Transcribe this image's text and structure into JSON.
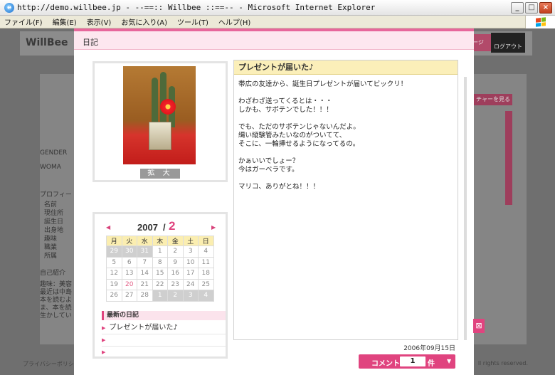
{
  "window": {
    "title": "http://demo.willbee.jp - --==:: Willbee ::==-- - Microsoft Internet Explorer",
    "menu": [
      "ファイル(F)",
      "編集(E)",
      "表示(V)",
      "お気に入り(A)",
      "ツール(T)",
      "ヘルプ(H)"
    ]
  },
  "background": {
    "logo": "WillBee",
    "logout": "ログアウト",
    "nav_partial": "ージ",
    "left_labels": [
      "GENDER",
      "WOMA",
      "プロフィー",
      "名前",
      "現住所",
      "誕生日",
      "出身地",
      "趣味",
      "職業",
      "所属",
      "自己紹介",
      "趣味：美容",
      "最近は中島",
      "本を読むよ",
      "ま、本を読",
      "生かしてい"
    ],
    "feature_button": "チャーを見る",
    "tab_numbers": [
      "4",
      "4",
      "4",
      "4"
    ],
    "footer_left": "プライバシーポリシ",
    "footer_right": "ll rights reserved."
  },
  "modal": {
    "header_title": "日記",
    "zoom_label": "拡 大",
    "entry": {
      "title": "プレゼントが届いた♪",
      "body": "帯広の友達から、誕生日プレゼントが届いてビックリ！\n\nわざわざ送ってくるとは・・・\nしかも、サボテンでした！！！\n\nでも、ただのサボテンじゃないんだよ。\n縄い縦験管みたいなのがついてて、\nそこに、一輪挿せるようになってるの。\n\nかぁいいでしょー？\n今はガーベラです。\n\nマリコ、ありがとね！！！",
      "date": "2006年09月15日"
    },
    "calendar": {
      "year": "2007",
      "slash": "/",
      "month": "2",
      "prev": "◀",
      "next": "▶",
      "weekdays": [
        "月",
        "火",
        "水",
        "木",
        "金",
        "土",
        "日"
      ],
      "weeks": [
        [
          {
            "d": "29",
            "out": true
          },
          {
            "d": "30",
            "out": true
          },
          {
            "d": "31",
            "out": true
          },
          {
            "d": "1"
          },
          {
            "d": "2"
          },
          {
            "d": "3"
          },
          {
            "d": "4"
          }
        ],
        [
          {
            "d": "5"
          },
          {
            "d": "6"
          },
          {
            "d": "7"
          },
          {
            "d": "8"
          },
          {
            "d": "9"
          },
          {
            "d": "10"
          },
          {
            "d": "11"
          }
        ],
        [
          {
            "d": "12"
          },
          {
            "d": "13"
          },
          {
            "d": "14"
          },
          {
            "d": "15"
          },
          {
            "d": "16"
          },
          {
            "d": "17"
          },
          {
            "d": "18"
          }
        ],
        [
          {
            "d": "19"
          },
          {
            "d": "20",
            "today": true
          },
          {
            "d": "21"
          },
          {
            "d": "22"
          },
          {
            "d": "23"
          },
          {
            "d": "24"
          },
          {
            "d": "25"
          }
        ],
        [
          {
            "d": "26"
          },
          {
            "d": "27"
          },
          {
            "d": "28"
          },
          {
            "d": "1",
            "out": true
          },
          {
            "d": "2",
            "out": true
          },
          {
            "d": "3",
            "out": true
          },
          {
            "d": "4",
            "out": true
          }
        ]
      ]
    },
    "recent": {
      "heading": "最新の日記",
      "items": [
        "プレゼントが届いた♪",
        "",
        ""
      ]
    },
    "comment": {
      "label": "コメント",
      "count": "1",
      "unit": "件",
      "caret": "▼"
    },
    "close_glyph": "⊠"
  }
}
